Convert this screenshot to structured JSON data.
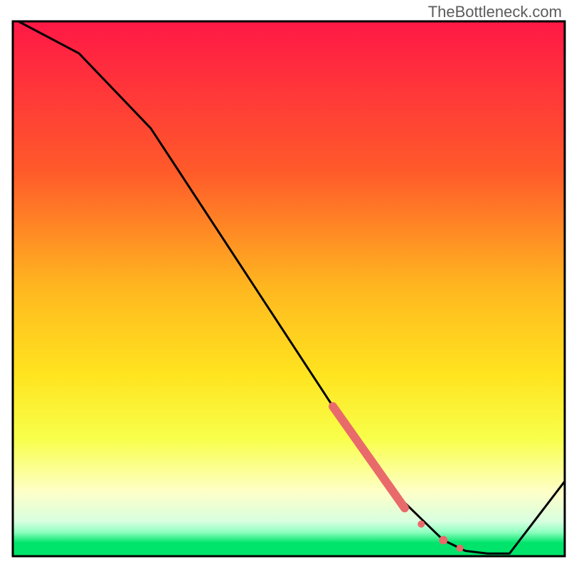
{
  "watermark": "TheBottleneck.com",
  "colors": {
    "gradient_top": "#ff1846",
    "gradient_upper_mid": "#ff7a1f",
    "gradient_mid": "#ffd21f",
    "gradient_lower_mid": "#f5ff3a",
    "gradient_pale": "#fdffd6",
    "gradient_green_top": "#8fffc0",
    "gradient_green": "#00e46b",
    "line": "#000000",
    "marker": "#e96a6a",
    "frame": "#000000"
  },
  "chart_data": {
    "type": "line",
    "title": "",
    "xlabel": "",
    "ylabel": "",
    "xlim": [
      0,
      100
    ],
    "ylim": [
      0,
      100
    ],
    "series": [
      {
        "name": "curve",
        "x": [
          1,
          12,
          25,
          58,
          62,
          66,
          70,
          72,
          75,
          78,
          82,
          86,
          90,
          100
        ],
        "y": [
          100,
          94,
          80,
          28,
          22,
          16,
          11,
          9,
          6,
          3,
          1,
          0.5,
          0.5,
          14
        ]
      }
    ],
    "highlight_segment": {
      "comment": "thick salmon segment along the line",
      "x": [
        58,
        71
      ],
      "y": [
        28,
        9
      ]
    },
    "markers": [
      {
        "x": 74,
        "y": 6,
        "r": 5
      },
      {
        "x": 78,
        "y": 3,
        "r": 6
      },
      {
        "x": 81,
        "y": 1.5,
        "r": 5
      }
    ]
  }
}
